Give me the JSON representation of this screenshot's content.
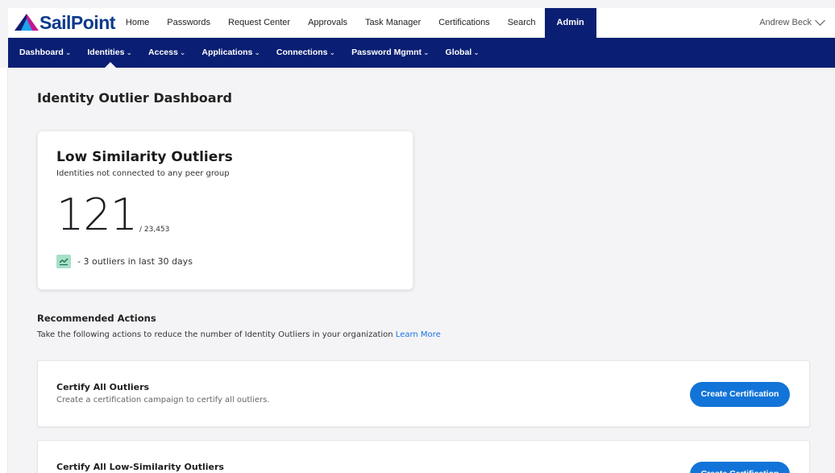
{
  "brand": {
    "name": "SailPoint",
    "colors": {
      "navy": "#0a1f73",
      "logo_blue": "#0b3a8c",
      "accent": "#1274d8"
    }
  },
  "topnav": {
    "items": [
      "Home",
      "Passwords",
      "Request Center",
      "Approvals",
      "Task Manager",
      "Certifications",
      "Search",
      "Admin"
    ],
    "active": "Admin",
    "user": "Andrew Beck"
  },
  "subnav": {
    "items": [
      {
        "label": "Dashboard"
      },
      {
        "label": "Identities"
      },
      {
        "label": "Access"
      },
      {
        "label": "Applications"
      },
      {
        "label": "Connections"
      },
      {
        "label": "Password Mgmnt"
      },
      {
        "label": "Global"
      }
    ],
    "selected": "Identities"
  },
  "page": {
    "title": "Identity Outlier Dashboard"
  },
  "outlier_card": {
    "title": "Low Similarity Outliers",
    "subtitle": "Identities not connected to any peer group",
    "count": "121",
    "total": "/ 23,453",
    "trend": "- 3 outliers in last 30 days",
    "trend_icon": "trend-chart-icon"
  },
  "recommended": {
    "title": "Recommended Actions",
    "description": "Take the following actions to reduce the number of Identity Outliers in your organization ",
    "learn_more": "Learn More",
    "actions": [
      {
        "title": "Certify All Outliers",
        "description": "Create a certification campaign to certify all outliers.",
        "button": "Create Certification"
      },
      {
        "title": "Certify All Low-Similarity Outliers",
        "description": "",
        "button": "Create Certification"
      }
    ]
  }
}
